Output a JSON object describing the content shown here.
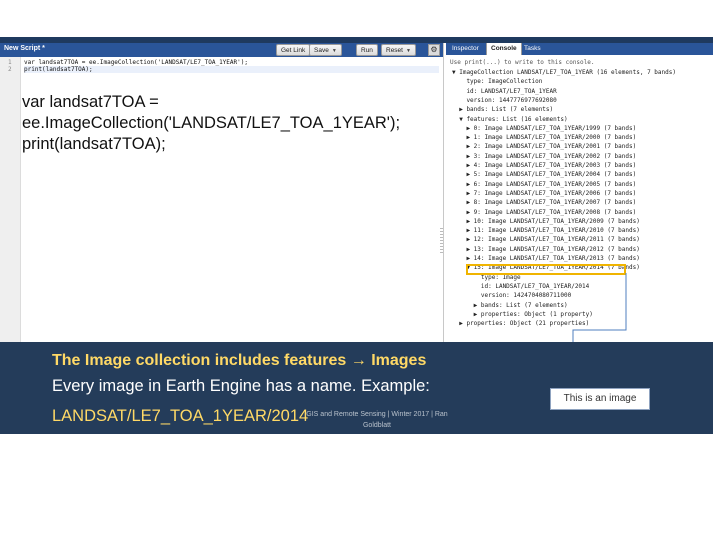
{
  "editor": {
    "title": "New Script *",
    "buttons": [
      "Get Link",
      "Save",
      "Run",
      "Reset"
    ],
    "code_lines": [
      {
        "num": "1",
        "text": "var landsat7TOA = ee.ImageCollection('LANDSAT/LE7_TOA_1YEAR');"
      },
      {
        "num": "2",
        "text": "print(landsat7TOA);"
      }
    ],
    "big_code": "var landsat7TOA =\nee.ImageCollection('LANDSAT/LE7_TOA_1YEAR');\nprint(landsat7TOA);"
  },
  "console": {
    "tabs": [
      "Inspector",
      "Console",
      "Tasks"
    ],
    "hint": "Use print(...) to write to this console.",
    "rows": [
      "▼ ImageCollection LANDSAT/LE7_TOA_1YEAR (16 elements, 7 bands)",
      "    type: ImageCollection",
      "    id: LANDSAT/LE7_TOA_1YEAR",
      "    version: 1447776977692080",
      "  ▶ bands: List (7 elements)",
      "  ▼ features: List (16 elements)",
      "    ▶ 0: Image LANDSAT/LE7_TOA_1YEAR/1999 (7 bands)",
      "    ▶ 1: Image LANDSAT/LE7_TOA_1YEAR/2000 (7 bands)",
      "    ▶ 2: Image LANDSAT/LE7_TOA_1YEAR/2001 (7 bands)",
      "    ▶ 3: Image LANDSAT/LE7_TOA_1YEAR/2002 (7 bands)",
      "    ▶ 4: Image LANDSAT/LE7_TOA_1YEAR/2003 (7 bands)",
      "    ▶ 5: Image LANDSAT/LE7_TOA_1YEAR/2004 (7 bands)",
      "    ▶ 6: Image LANDSAT/LE7_TOA_1YEAR/2005 (7 bands)",
      "    ▶ 7: Image LANDSAT/LE7_TOA_1YEAR/2006 (7 bands)",
      "    ▶ 8: Image LANDSAT/LE7_TOA_1YEAR/2007 (7 bands)",
      "    ▶ 9: Image LANDSAT/LE7_TOA_1YEAR/2008 (7 bands)",
      "    ▶ 10: Image LANDSAT/LE7_TOA_1YEAR/2009 (7 bands)",
      "    ▶ 11: Image LANDSAT/LE7_TOA_1YEAR/2010 (7 bands)",
      "    ▶ 12: Image LANDSAT/LE7_TOA_1YEAR/2011 (7 bands)",
      "    ▶ 13: Image LANDSAT/LE7_TOA_1YEAR/2012 (7 bands)",
      "    ▶ 14: Image LANDSAT/LE7_TOA_1YEAR/2013 (7 bands)",
      "    ▼ 15: Image LANDSAT/LE7_TOA_1YEAR/2014 (7 bands)",
      "        type: Image",
      "        id: LANDSAT/LE7_TOA_1YEAR/2014",
      "        version: 1424704080711000",
      "      ▶ bands: List (7 elements)",
      "      ▶ properties: Object (1 property)",
      "  ▶ properties: Object (21 properties)"
    ]
  },
  "slide": {
    "heading_start": "The Image collection includes features ",
    "heading_arrow": "→",
    "heading_end": " Images",
    "line2": "Every image in Earth Engine has a name. Example:",
    "line3": "LANDSAT/LE7_TOA_1YEAR/2014",
    "footer": "GIS and Remote Sensing | Winter 2017 | Ran Goldblatt",
    "callout": "This is an image"
  },
  "colors": {
    "band": "#243c5a",
    "highlight": "#ffd966",
    "box": "#f0b400",
    "header": "#2a5599"
  }
}
